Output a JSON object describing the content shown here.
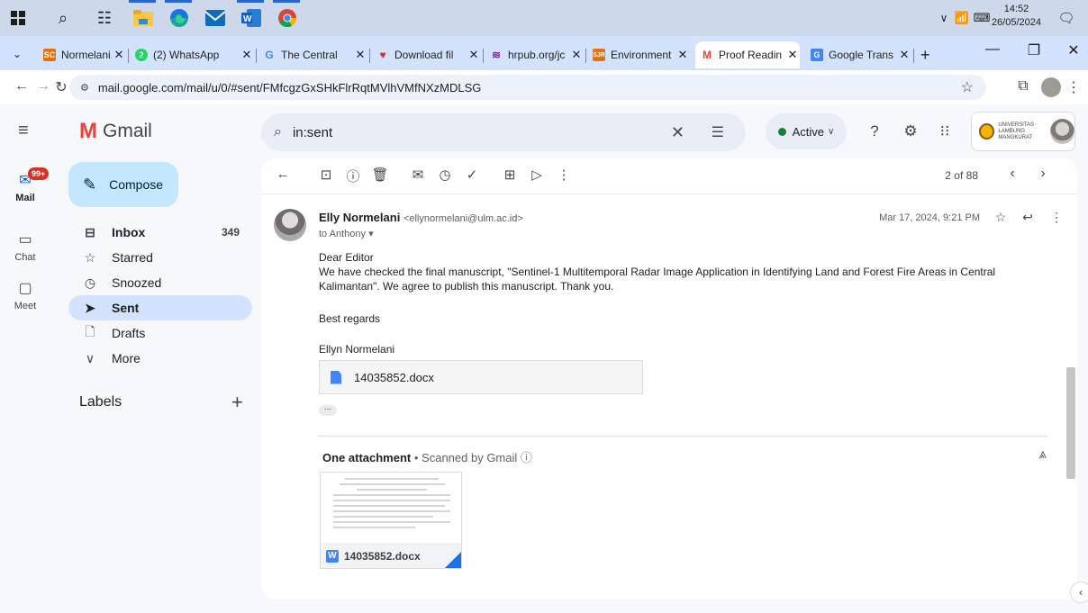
{
  "taskbar": {
    "time": "14:52",
    "date": "26/05/2024"
  },
  "browser": {
    "tabs": [
      {
        "label": "Normelani, E",
        "fav_text": "SC",
        "fav_color": "#e8710a"
      },
      {
        "label": "(2) WhatsApp",
        "fav_text": "2",
        "fav_color": "#25d366"
      },
      {
        "label": "The Central",
        "fav_text": "G",
        "fav_color": "#ffffff"
      },
      {
        "label": "Download fil",
        "fav_text": "♥",
        "fav_color": "#ffffff"
      },
      {
        "label": "hrpub.org/jc",
        "fav_text": "≋",
        "fav_color": "#ffffff"
      },
      {
        "label": "Environment",
        "fav_text": "SJR",
        "fav_color": "#e8710a"
      },
      {
        "label": "Proof Readin",
        "fav_text": "M",
        "fav_color": "#ffffff"
      },
      {
        "label": "Google Trans",
        "fav_text": "G",
        "fav_color": "#4285f4"
      }
    ],
    "url": "mail.google.com/mail/u/0/#sent/FMfcgzGxSHkFlrRqtMVlhVMfNXzMDLSG"
  },
  "gmail": {
    "app_name": "Gmail",
    "search_value": "in:sent",
    "status": "Active",
    "account_org": "UNIVERSITAS LAMBUNG MANGKURAT",
    "rail": {
      "mail_badge": "99+",
      "mail": "Mail",
      "chat": "Chat",
      "meet": "Meet"
    },
    "compose": "Compose",
    "nav": [
      {
        "label": "Inbox",
        "count": "349"
      },
      {
        "label": "Starred",
        "count": ""
      },
      {
        "label": "Snoozed",
        "count": ""
      },
      {
        "label": "Sent",
        "count": ""
      },
      {
        "label": "Drafts",
        "count": ""
      },
      {
        "label": "More",
        "count": ""
      }
    ],
    "labels_heading": "Labels",
    "pager": "2 of 88"
  },
  "message": {
    "sender_name": "Elly Normelani",
    "sender_email": "<ellynormelani@ulm.ac.id>",
    "to": "to Anthony",
    "date": "Mar 17, 2024, 9:21 PM",
    "greeting": "Dear Editor",
    "body": "We have checked the final manuscript, \"Sentinel-1 Multitemporal Radar Image Application in Identifying Land and Forest Fire Areas in Central Kalimantan\". We agree to publish this manuscript. Thank you.",
    "closing": "Best regards",
    "signature": "Ellyn Normelani",
    "attachment_name": "14035852.docx",
    "attachments_heading": "One attachment",
    "scanned_text": "Scanned by Gmail"
  }
}
